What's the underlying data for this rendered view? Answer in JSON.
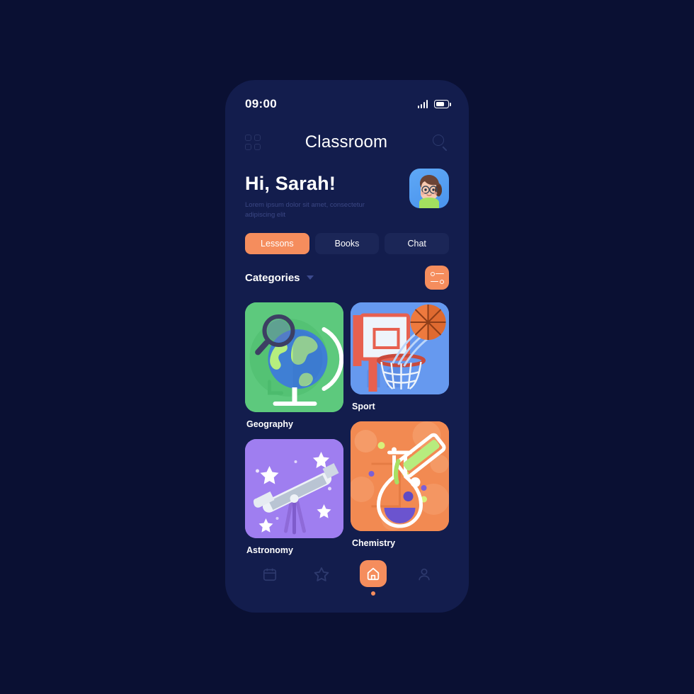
{
  "statusbar": {
    "time": "09:00",
    "signal_icon": "signal-bars-icon",
    "battery_icon": "battery-icon"
  },
  "header": {
    "title": "Classroom",
    "grid_icon": "grid-menu-icon",
    "search_icon": "search-icon"
  },
  "greeting": {
    "title": "Hi, Sarah!",
    "subtitle": "Lorem ipsum dolor sit amet, consectetur adipiscing elit",
    "avatar_icon": "user-avatar"
  },
  "tabs": [
    {
      "label": "Lessons",
      "active": true
    },
    {
      "label": "Books",
      "active": false
    },
    {
      "label": "Chat",
      "active": false
    }
  ],
  "categories_section": {
    "title": "Categories",
    "chevron_icon": "chevron-down-icon",
    "filter_icon": "filter-sliders-icon"
  },
  "categories": [
    {
      "label": "Geography",
      "color": "#5dc97d",
      "illustration": "globe-magnifier"
    },
    {
      "label": "Sport",
      "color": "#6699ef",
      "illustration": "basketball-hoop"
    },
    {
      "label": "Astronomy",
      "color": "#9f7ef0",
      "illustration": "telescope-stars"
    },
    {
      "label": "Chemistry",
      "color": "#f28a52",
      "illustration": "flask-testtube"
    }
  ],
  "bottom_nav": [
    {
      "name": "calendar-icon",
      "active": false
    },
    {
      "name": "star-icon",
      "active": false
    },
    {
      "name": "home-icon",
      "active": true
    },
    {
      "name": "profile-icon",
      "active": false
    }
  ],
  "theme": {
    "background": "#0a1033",
    "phone_background": "#131d4d",
    "accent": "#f58d5d",
    "tab_inactive": "#1b2657",
    "muted_text": "#3b4784"
  }
}
